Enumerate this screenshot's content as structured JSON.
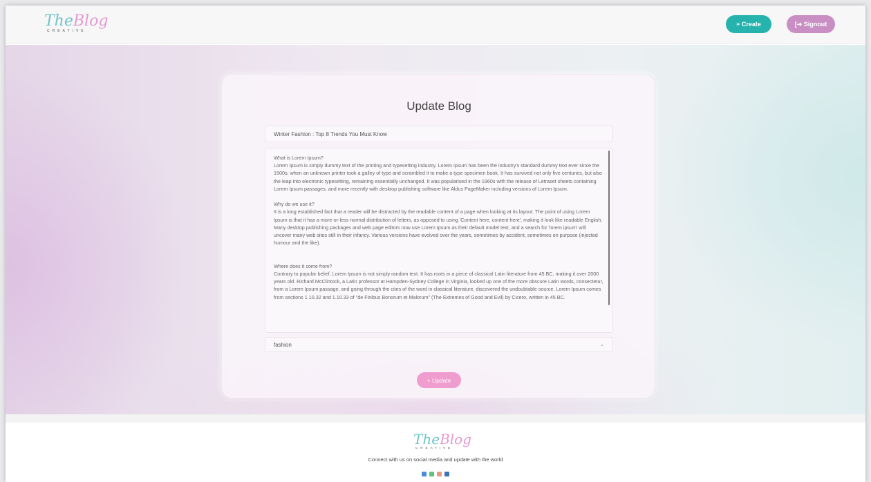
{
  "brand": {
    "script_part1": "The",
    "script_part2": "Blog",
    "word": "CREATIVE"
  },
  "header": {
    "create_label": "+ Create",
    "signout_label": "[➜ Signout"
  },
  "form": {
    "heading": "Update Blog",
    "title_value": "Winter Fashion : Top 8 Trends You Must Know",
    "content_value": "What is Lorem Ipsum?\nLorem Ipsum is simply dummy text of the printing and typesetting industry. Lorem Ipsum has been the industry's standard dummy text ever since the 1500s, when an unknown printer took a galley of type and scrambled it to make a type specimen book. It has survived not only five centuries, but also the leap into electronic typesetting, remaining essentially unchanged. It was popularised in the 1960s with the release of Letraset sheets containing Lorem Ipsum passages, and more recently with desktop publishing software like Aldus PageMaker including versions of Lorem Ipsum.\n\nWhy do we use it?\nIt is a long established fact that a reader will be distracted by the readable content of a page when looking at its layout. The point of using Lorem Ipsum is that it has a more-or-less normal distribution of letters, as opposed to using 'Content here, content here', making it look like readable English. Many desktop publishing packages and web page editors now use Lorem Ipsum as their default model text, and a search for 'lorem ipsum' will uncover many web sites still in their infancy. Various versions have evolved over the years, sometimes by accident, sometimes on purpose (injected humour and the like).\n\n\nWhere does it come from?\nContrary to popular belief, Lorem Ipsum is not simply random text. It has roots in a piece of classical Latin literature from 45 BC, making it over 2000 years old. Richard McClintock, a Latin professor at Hampden-Sydney College in Virginia, looked up one of the more obscure Latin words, consectetur, from a Lorem Ipsum passage, and going through the cites of the word in classical literature, discovered the undoubtable source. Lorem Ipsum comes from sections 1.10.32 and 1.10.33 of \"de Finibus Bonorum et Malorum\" (The Extremes of Good and Evil) by Cicero, written in 45 BC.",
    "category_value": "fashion",
    "update_label": "+ Update"
  },
  "footer": {
    "text": "Connect with us on social media and update with the world"
  },
  "colors": {
    "create": "#26b3ad",
    "signout": "#c98fc4",
    "update": "#ef9ccf",
    "facebook": "#4a8fd6",
    "whatsapp": "#5cc77c",
    "instagram": "#e79a84",
    "linkedin": "#3f73b8"
  },
  "icons": {
    "social": [
      "facebook-icon",
      "whatsapp-icon",
      "instagram-icon",
      "linkedin-icon"
    ]
  }
}
